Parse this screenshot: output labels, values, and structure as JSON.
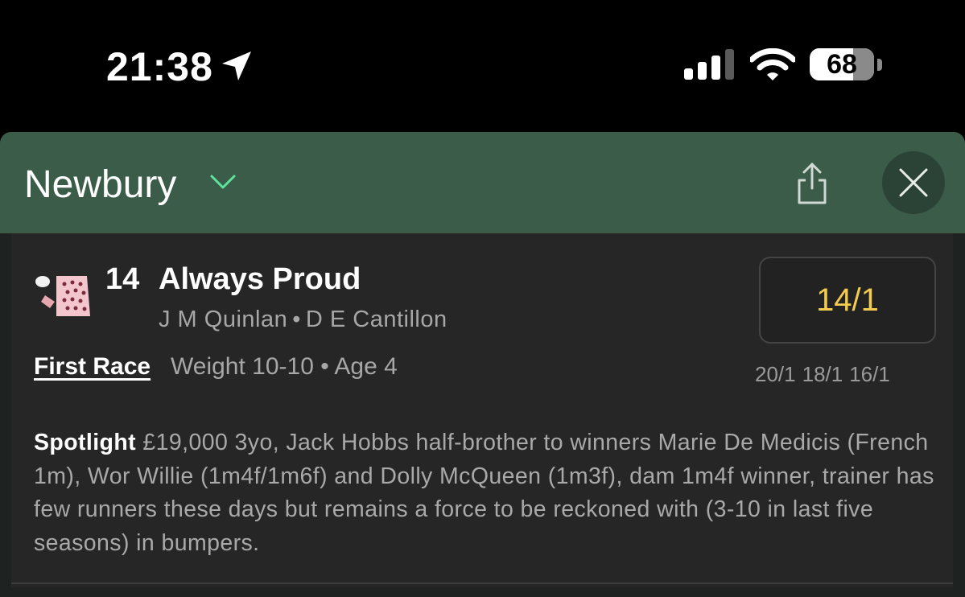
{
  "status_bar": {
    "time": "21:38",
    "battery_level": "68",
    "battery_fraction": 0.68,
    "icons": [
      "location-arrow-icon",
      "cellular-signal-icon",
      "wifi-icon",
      "battery-icon"
    ]
  },
  "header": {
    "venue": "Newbury",
    "icons": [
      "chevron-down-icon",
      "share-icon",
      "close-icon"
    ],
    "background_color": "#3a5c48"
  },
  "runner": {
    "number": "14",
    "name": "Always Proud",
    "jockey": "J M Quinlan",
    "separator": "•",
    "trainer": "D E Cantillon",
    "first_race_label": "First Race",
    "weight_age": "Weight 10-10 • Age 4",
    "odds": "14/1",
    "odds_color": "#f3cb4f",
    "previous_odds": [
      "20/1",
      "18/1",
      "16/1"
    ]
  },
  "spotlight": {
    "label": "Spotlight",
    "text": "£19,000 3yo, Jack Hobbs half-brother to winners Marie De Medicis (French 1m), Wor Willie (1m4f/1m6f) and Dolly McQueen (1m3f), dam 1m4f winner, trainer has few runners these days but remains a force to be reckoned with (3-10 in last five seasons) in bumpers."
  }
}
